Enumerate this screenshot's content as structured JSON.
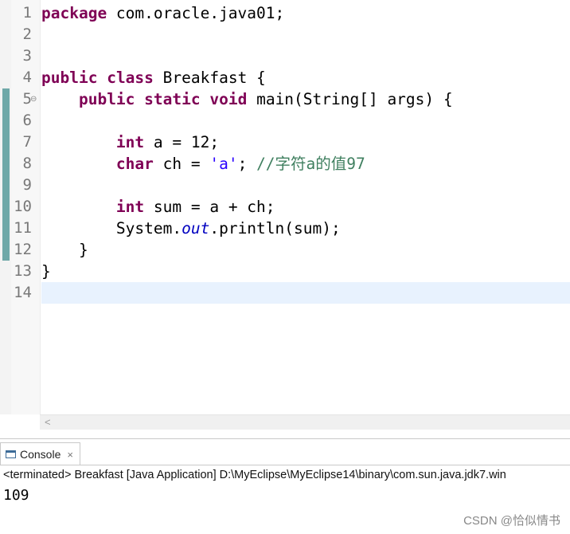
{
  "editor": {
    "line_numbers": [
      "1",
      "2",
      "3",
      "4",
      "5",
      "6",
      "7",
      "8",
      "9",
      "10",
      "11",
      "12",
      "13",
      "14"
    ],
    "lines": [
      [
        {
          "t": "package",
          "c": "kw"
        },
        {
          "t": " com.oracle.java01;"
        }
      ],
      [],
      [],
      [
        {
          "t": "public",
          "c": "kw"
        },
        {
          "t": " "
        },
        {
          "t": "class",
          "c": "kw"
        },
        {
          "t": " Breakfast {"
        }
      ],
      [
        {
          "t": "    "
        },
        {
          "t": "public",
          "c": "kw"
        },
        {
          "t": " "
        },
        {
          "t": "static",
          "c": "kw"
        },
        {
          "t": " "
        },
        {
          "t": "void",
          "c": "kw"
        },
        {
          "t": " main(String[] args) {"
        }
      ],
      [],
      [
        {
          "t": "        "
        },
        {
          "t": "int",
          "c": "kw"
        },
        {
          "t": " a = 12;"
        }
      ],
      [
        {
          "t": "        "
        },
        {
          "t": "char",
          "c": "kw"
        },
        {
          "t": " ch = "
        },
        {
          "t": "'a'",
          "c": "str"
        },
        {
          "t": "; "
        },
        {
          "t": "//字符a的值97",
          "c": "cmt"
        }
      ],
      [],
      [
        {
          "t": "        "
        },
        {
          "t": "int",
          "c": "kw"
        },
        {
          "t": " sum = a + ch;"
        }
      ],
      [
        {
          "t": "        System."
        },
        {
          "t": "out",
          "c": "fld"
        },
        {
          "t": ".println(sum);"
        }
      ],
      [
        {
          "t": "    }"
        }
      ],
      [
        {
          "t": "}"
        }
      ],
      []
    ],
    "fold_marker": "⊖"
  },
  "scrollbar": {
    "left_arrow": "<"
  },
  "console": {
    "tab_label": "Console",
    "close_glyph": "×",
    "status": "<terminated> Breakfast [Java Application] D:\\MyEclipse\\MyEclipse14\\binary\\com.sun.java.jdk7.win",
    "output": "109"
  },
  "watermark": "CSDN @恰似情书"
}
